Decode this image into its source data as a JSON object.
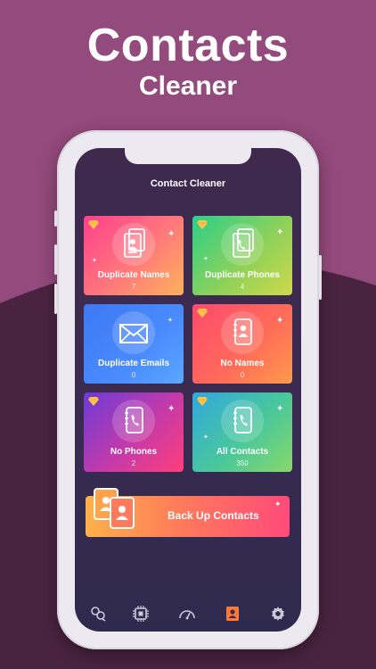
{
  "promo": {
    "line1": "Contacts",
    "line2": "Cleaner"
  },
  "app": {
    "title": "Contact Cleaner"
  },
  "cards": [
    {
      "label": "Duplicate Names",
      "count": "7",
      "icon": "contact-book-icon"
    },
    {
      "label": "Duplicate Phones",
      "count": "4",
      "icon": "phone-book-icon"
    },
    {
      "label": "Duplicate Emails",
      "count": "0",
      "icon": "envelope-icon"
    },
    {
      "label": "No Names",
      "count": "0",
      "icon": "contact-book-icon"
    },
    {
      "label": "No Phones",
      "count": "2",
      "icon": "phone-book-icon"
    },
    {
      "label": "All Contacts",
      "count": "350",
      "icon": "phone-book-icon"
    }
  ],
  "backup": {
    "label": "Back Up Contacts"
  },
  "tabs": [
    "merge-icon",
    "chip-icon",
    "speedometer-icon",
    "contacts-icon",
    "gear-icon"
  ],
  "colors": {
    "background": "#934a7c",
    "accent": "#ff4a7a",
    "active_tab": "#ff7a3a"
  }
}
